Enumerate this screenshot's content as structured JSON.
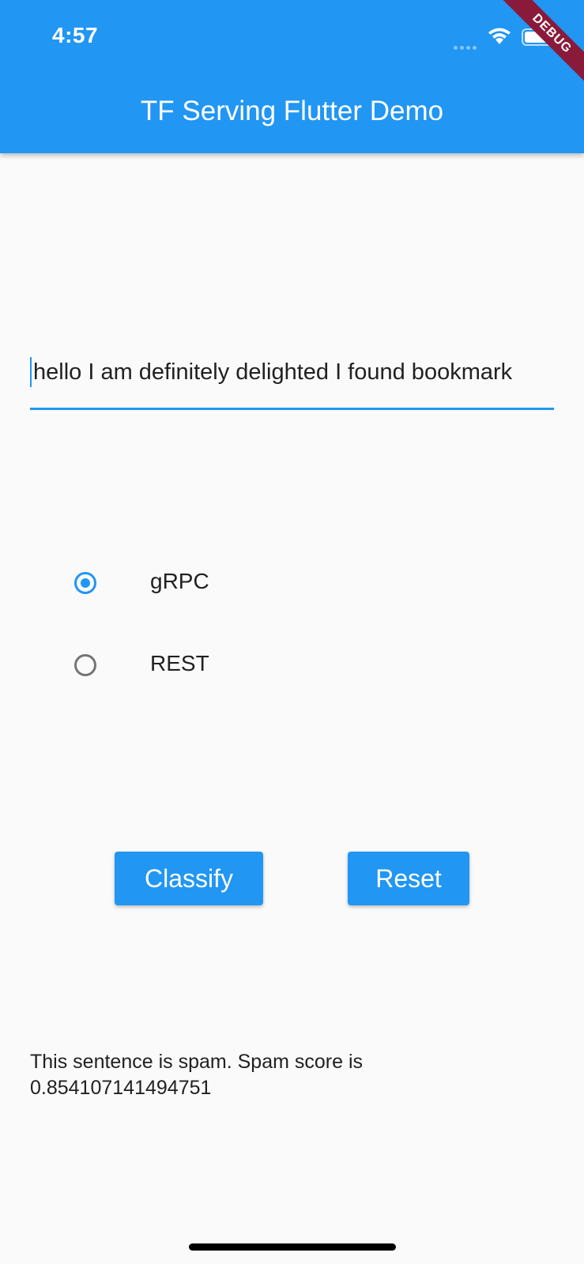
{
  "status_bar": {
    "time": "4:57"
  },
  "debug_banner": "DEBUG",
  "app_bar": {
    "title": "TF Serving Flutter Demo"
  },
  "input": {
    "value": "hello I am definitely delighted I found bookmark"
  },
  "protocol_options": [
    {
      "label": "gRPC",
      "selected": true
    },
    {
      "label": "REST",
      "selected": false
    }
  ],
  "buttons": {
    "classify": "Classify",
    "reset": "Reset"
  },
  "result": {
    "text": "This sentence is spam. Spam score is 0.854107141494751"
  },
  "colors": {
    "primary": "#2196f3",
    "background": "#fafafa",
    "text": "#212121",
    "unselected_radio": "#757575"
  },
  "icons": {
    "signal": "cellular-signal-icon",
    "wifi": "wifi-icon",
    "battery": "battery-icon"
  }
}
